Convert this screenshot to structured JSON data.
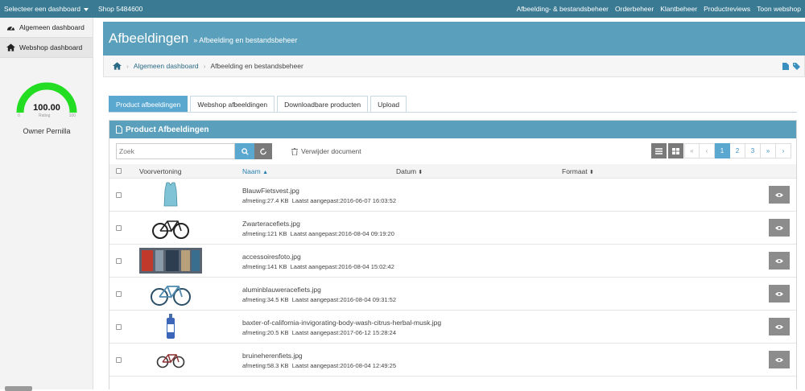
{
  "topbar": {
    "dashboard_select": "Selecteer een dashboard",
    "shop": "Shop  5484600",
    "nav": [
      "Afbeelding- & bestandsbeheer",
      "Orderbeheer",
      "Klantbeheer",
      "Productreviews",
      "Toon webshop"
    ]
  },
  "sidebar": {
    "items": [
      {
        "label": "Algemeen dashboard",
        "icon": "tachometer-icon"
      },
      {
        "label": "Webshop dashboard",
        "icon": "home-icon"
      }
    ],
    "gauge": {
      "value": "100.00",
      "min": "0",
      "max": "100",
      "caption": "Rating",
      "fill": 1.0
    },
    "owner": "Owner Pernilla"
  },
  "header": {
    "title": "Afbeeldingen",
    "sep": "»",
    "subtitle": "Afbeelding en bestandsbeheer"
  },
  "breadcrumb": {
    "home": "home-icon",
    "items": [
      "Algemeen dashboard",
      "Afbeelding en bestandsbeheer"
    ]
  },
  "tabs": [
    "Product afbeeldingen",
    "Webshop afbeeldingen",
    "Downloadbare producten",
    "Upload"
  ],
  "panel": {
    "title": "Product Afbeeldingen",
    "search_placeholder": "Zoek",
    "delete_label": "Verwijder document",
    "pager": [
      "«",
      "‹",
      "1",
      "2",
      "3",
      "»",
      "›"
    ],
    "active_page": "1",
    "columns": {
      "preview": "Voorvertoning",
      "name": "Naam",
      "date": "Datum",
      "format": "Formaat"
    }
  },
  "rows": [
    {
      "name": "BlauwFietsvest.jpg",
      "size": "afmeting:27.4 KB",
      "modified": "Laatst aangepast:2016-06-07 16:03:52",
      "thumb": "vest"
    },
    {
      "name": "Zwarteracefiets.jpg",
      "size": "afmeting:121 KB",
      "modified": "Laatst aangepast:2016-08-04 09:19:20",
      "thumb": "bike-black"
    },
    {
      "name": "accessoiresfoto.jpg",
      "size": "afmeting:141 KB",
      "modified": "Laatst aangepast:2016-08-04 15:02:42",
      "thumb": "shop"
    },
    {
      "name": "aluminblauweracefiets.jpg",
      "size": "afmeting:34.5 KB",
      "modified": "Laatst aangepast:2016-08-04 09:31:52",
      "thumb": "bike-blue"
    },
    {
      "name": "baxter-of-california-invigorating-body-wash-citrus-herbal-musk.jpg",
      "size": "afmeting:20.5 KB",
      "modified": "Laatst aangepast:2017-06-12 15:28:24",
      "thumb": "bottle"
    },
    {
      "name": "bruineherenfiets.jpg",
      "size": "afmeting:58.3 KB",
      "modified": "Laatst aangepast:2016-08-04 12:49:25",
      "thumb": "bike-brown"
    }
  ],
  "colors": {
    "topbar": "#3a7a93",
    "header": "#5a9fbb",
    "accent": "#5aa8d0",
    "gauge": "#22dd22"
  }
}
